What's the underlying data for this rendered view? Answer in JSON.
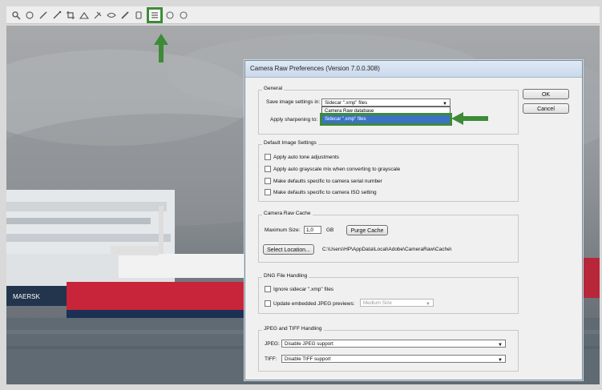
{
  "toolbar": {
    "icons": [
      "zoom-icon",
      "hand-icon",
      "white-balance-icon",
      "color-sampler-icon",
      "crop-icon",
      "straighten-icon",
      "spot-removal-icon",
      "red-eye-icon",
      "brush-icon",
      "graduated-filter-icon",
      "preferences-icon",
      "rotate-left-icon",
      "rotate-right-icon"
    ],
    "highlighted": "preferences-icon",
    "highlight_color": "#3d8b37"
  },
  "dialog": {
    "title": "Camera Raw Preferences  (Version 7.0.0.308)",
    "ok_label": "OK",
    "cancel_label": "Cancel",
    "general": {
      "title": "General",
      "save_label": "Save image settings in:",
      "save_value": "Sidecar \".xmp\" files",
      "dropdown_options": [
        "Camera Raw database",
        "Sidecar \".xmp\" files"
      ],
      "sharpen_label": "Apply sharpening to:"
    },
    "defaults": {
      "title": "Default Image Settings",
      "options": [
        "Apply auto tone adjustments",
        "Apply auto grayscale mix when converting to grayscale",
        "Make defaults specific to camera serial number",
        "Make defaults specific to camera ISO setting"
      ]
    },
    "cache": {
      "title": "Camera Raw Cache",
      "max_size_label": "Maximum Size:",
      "max_size_value": "1,0",
      "unit": "GB",
      "purge_label": "Purge Cache",
      "select_label": "Select Location...",
      "path": "C:\\Users\\HP\\AppData\\Local\\Adobe\\CameraRaw\\Cache\\"
    },
    "dng": {
      "title": "DNG File Handling",
      "ignore_label": "Ignore sidecar \".xmp\" files",
      "update_label": "Update embedded JPEG previews:",
      "preview_size": "Medium Size"
    },
    "jpeg": {
      "title": "JPEG and TIFF Handling",
      "jpeg_label": "JPEG:",
      "jpeg_value": "Disable JPEG support",
      "tiff_label": "TIFF:",
      "tiff_value": "Disable TIFF support"
    }
  },
  "photo": {
    "ship_text": "MAERSK"
  }
}
